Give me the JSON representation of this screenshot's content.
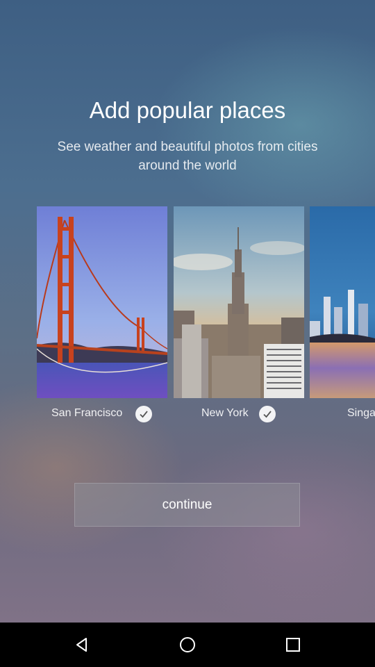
{
  "onboarding": {
    "title": "Add popular places",
    "subtitle": "See weather and beautiful photos from cities around the world",
    "continue_label": "continue"
  },
  "cities": [
    {
      "name": "San Francisco",
      "selected": true,
      "image": "golden-gate-bridge"
    },
    {
      "name": "New York",
      "selected": true,
      "image": "empire-state-skyline"
    },
    {
      "name": "Singa",
      "selected": false,
      "image": "waterfront-skyline-night"
    }
  ],
  "navbar": {
    "back_icon": "triangle-back-icon",
    "home_icon": "circle-home-icon",
    "recents_icon": "square-recents-icon"
  },
  "colors": {
    "bridge": "#c8421e",
    "button_bg": "#8c8c96"
  }
}
